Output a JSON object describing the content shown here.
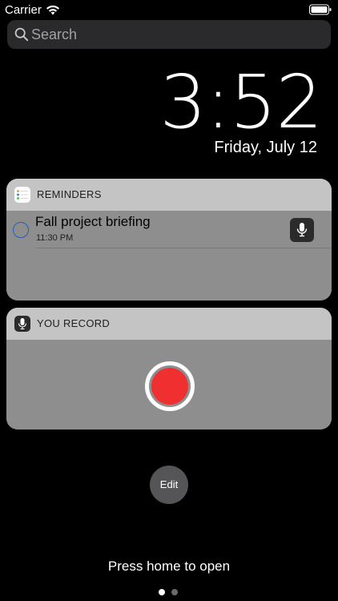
{
  "status_bar": {
    "carrier": "Carrier",
    "wifi_icon": "wifi-icon",
    "battery_icon": "battery-icon"
  },
  "search": {
    "placeholder": "Search",
    "value": "",
    "icon": "search-icon"
  },
  "lock_screen": {
    "time": "3:52",
    "date": "Friday, July 12"
  },
  "widgets": {
    "reminders": {
      "title": "REMINDERS",
      "icon": "reminders-app-icon",
      "items": [
        {
          "title": "Fall project briefing",
          "time": "11:30 PM",
          "action_icon": "microphone-icon"
        }
      ]
    },
    "you_record": {
      "title": "YOU RECORD",
      "icon": "microphone-app-icon",
      "record_icon": "record-icon",
      "record_color": "#f03030"
    }
  },
  "edit_label": "Edit",
  "footer": {
    "hint": "Press home to open",
    "page_count": 2,
    "current_page": 1
  },
  "colors": {
    "background": "#000000",
    "widget_header": "#c4c4c4",
    "widget_body": "#8e8e8e",
    "search_bg": "#2a2a2c",
    "reminder_circle": "#1f5fb5"
  }
}
